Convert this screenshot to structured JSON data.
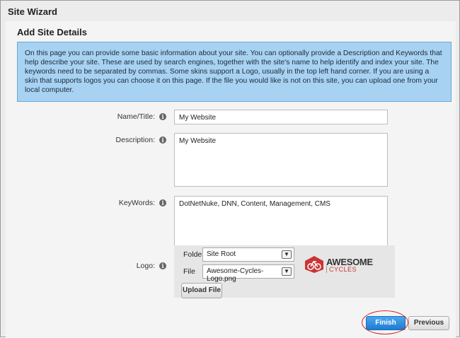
{
  "wizard": {
    "title": "Site Wizard"
  },
  "section": {
    "title": "Add Site Details"
  },
  "info": {
    "text": "On this page you can provide some basic information about your site. You can optionally provide a Description and Keywords that help describe your site. These are used by search engines, together with the site's name to help identify and index your site. The keywords need to be separated by commas. Some skins support a Logo, usually in the top left hand corner. If you are using a skin that supports logos you can choose it on this page. If the file you would like is not on this site, you can upload one from your local computer."
  },
  "form": {
    "name": {
      "label": "Name/Title:",
      "value": "My Website"
    },
    "description": {
      "label": "Description:",
      "value": "My Website"
    },
    "keywords": {
      "label": "KeyWords:",
      "value": "DotNetNuke, DNN, Content, Management, CMS"
    },
    "logo": {
      "label": "Logo:",
      "folder_label": "Folder",
      "folder_value": "Site Root",
      "file_label": "File",
      "file_value": "Awesome-Cycles-Logo.png",
      "upload_label": "Upload File",
      "preview_name": "AWESOME",
      "preview_sub": "CYCLES"
    }
  },
  "buttons": {
    "finish": "Finish",
    "previous": "Previous"
  },
  "icons": {
    "info": "info-icon",
    "dropdown": "chevron-down-icon"
  },
  "colors": {
    "accent": "#1e7bd0",
    "info_bg": "#a8d2f2",
    "highlight": "#d42020",
    "logo_red": "#cc3333"
  }
}
